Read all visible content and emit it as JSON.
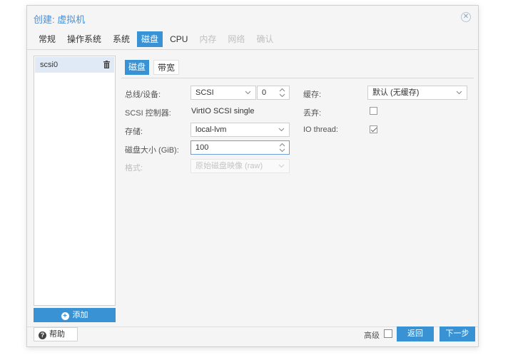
{
  "window": {
    "title": "创建: 虚拟机",
    "close_glyph": "✕"
  },
  "tabs": [
    {
      "label": "常规",
      "state": "normal"
    },
    {
      "label": "操作系统",
      "state": "normal"
    },
    {
      "label": "系统",
      "state": "normal"
    },
    {
      "label": "磁盘",
      "state": "active"
    },
    {
      "label": "CPU",
      "state": "normal"
    },
    {
      "label": "内存",
      "state": "disabled"
    },
    {
      "label": "网络",
      "state": "disabled"
    },
    {
      "label": "确认",
      "state": "disabled"
    }
  ],
  "disk_list": {
    "items": [
      {
        "label": "scsi0"
      }
    ],
    "add_button": "添加",
    "add_glyph": "+"
  },
  "inner_tabs": [
    {
      "label": "磁盘"
    },
    {
      "label": "带宽"
    }
  ],
  "form": {
    "bus_device_label": "总线/设备:",
    "bus_value": "SCSI",
    "device_index": "0",
    "scsi_controller_label": "SCSI 控制器:",
    "scsi_controller_value": "VirtIO SCSI single",
    "storage_label": "存储:",
    "storage_value": "local-lvm",
    "disk_size_label": "磁盘大小 (GiB):",
    "disk_size_value": "100",
    "format_label": "格式:",
    "format_value": "原始磁盘映像 (raw)",
    "cache_label": "缓存:",
    "cache_value": "默认 (无缓存)",
    "discard_label": "丢弃:",
    "discard_checked": false,
    "io_thread_label": "IO thread:",
    "io_thread_checked": true
  },
  "footer": {
    "help_label": "帮助",
    "help_glyph": "?",
    "advanced_label": "高级",
    "back_label": "返回",
    "next_label": "下一步"
  },
  "colors": {
    "accent": "#3892d4",
    "title": "#4a8fd6"
  }
}
